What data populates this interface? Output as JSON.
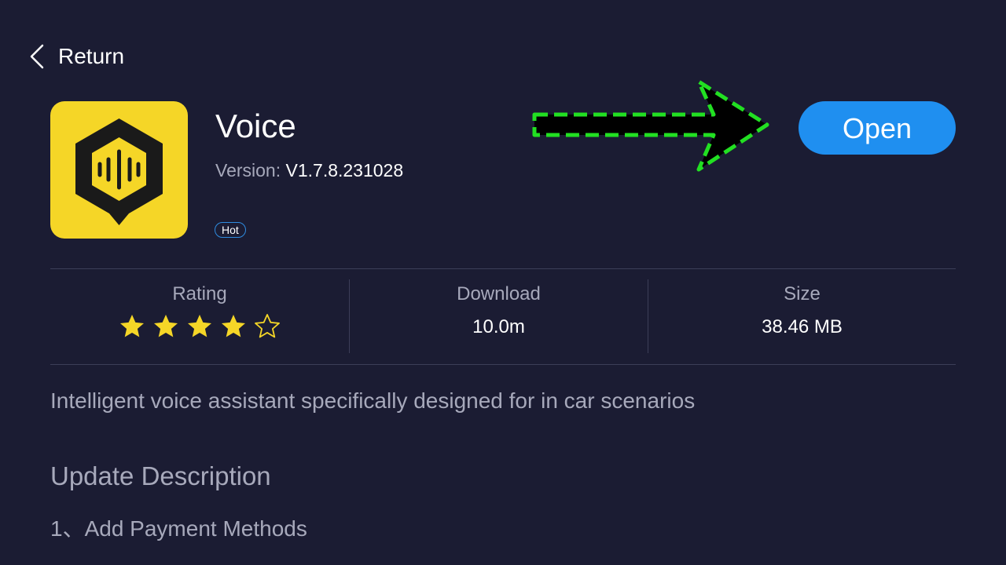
{
  "header": {
    "return_label": "Return"
  },
  "app": {
    "name": "Voice",
    "version_label": "Version:",
    "version": "V1.7.8.231028",
    "badge": "Hot",
    "icon": "voice-waveform-icon",
    "icon_color": "#f5d627"
  },
  "actions": {
    "open_label": "Open",
    "open_color": "#1f8ff0"
  },
  "annotation": {
    "icon": "dashed-arrow-icon",
    "color": "#22e022"
  },
  "stats": {
    "rating": {
      "label": "Rating",
      "stars_filled": 4,
      "stars_total": 5
    },
    "download": {
      "label": "Download",
      "value": "10.0m"
    },
    "size": {
      "label": "Size",
      "value": "38.46 MB"
    }
  },
  "description": "Intelligent voice assistant specifically designed for in car scenarios",
  "update": {
    "title": "Update Description",
    "items": [
      "1、Add Payment Methods"
    ]
  },
  "colors": {
    "background": "#1b1c33",
    "star": "#f5d627",
    "muted_text": "#a7a9bb"
  }
}
